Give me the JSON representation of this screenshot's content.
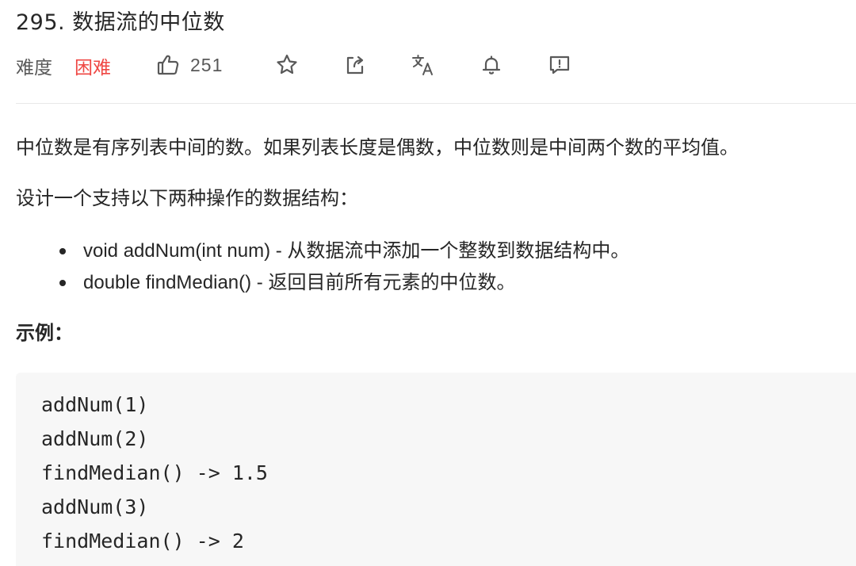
{
  "problem": {
    "title": "295. 数据流的中位数",
    "difficulty_label": "难度",
    "difficulty_value": "困难",
    "difficulty_color": "#ef4743",
    "likes": "251"
  },
  "toolbar": {
    "icons": [
      "thumbs-up-icon",
      "star-icon",
      "share-icon",
      "translate-icon",
      "bell-icon",
      "feedback-icon"
    ]
  },
  "description": {
    "paragraph_1": "中位数是有序列表中间的数。如果列表长度是偶数，中位数则是中间两个数的平均值。",
    "paragraph_2": "设计一个支持以下两种操作的数据结构：",
    "bullets": [
      "void addNum(int num) - 从数据流中添加一个整数到数据结构中。",
      "double findMedian() - 返回目前所有元素的中位数。"
    ]
  },
  "example": {
    "heading": "示例：",
    "code_lines": [
      "addNum(1)",
      "addNum(2)",
      "findMedian() -> 1.5",
      "addNum(3)",
      "findMedian() -> 2"
    ]
  }
}
